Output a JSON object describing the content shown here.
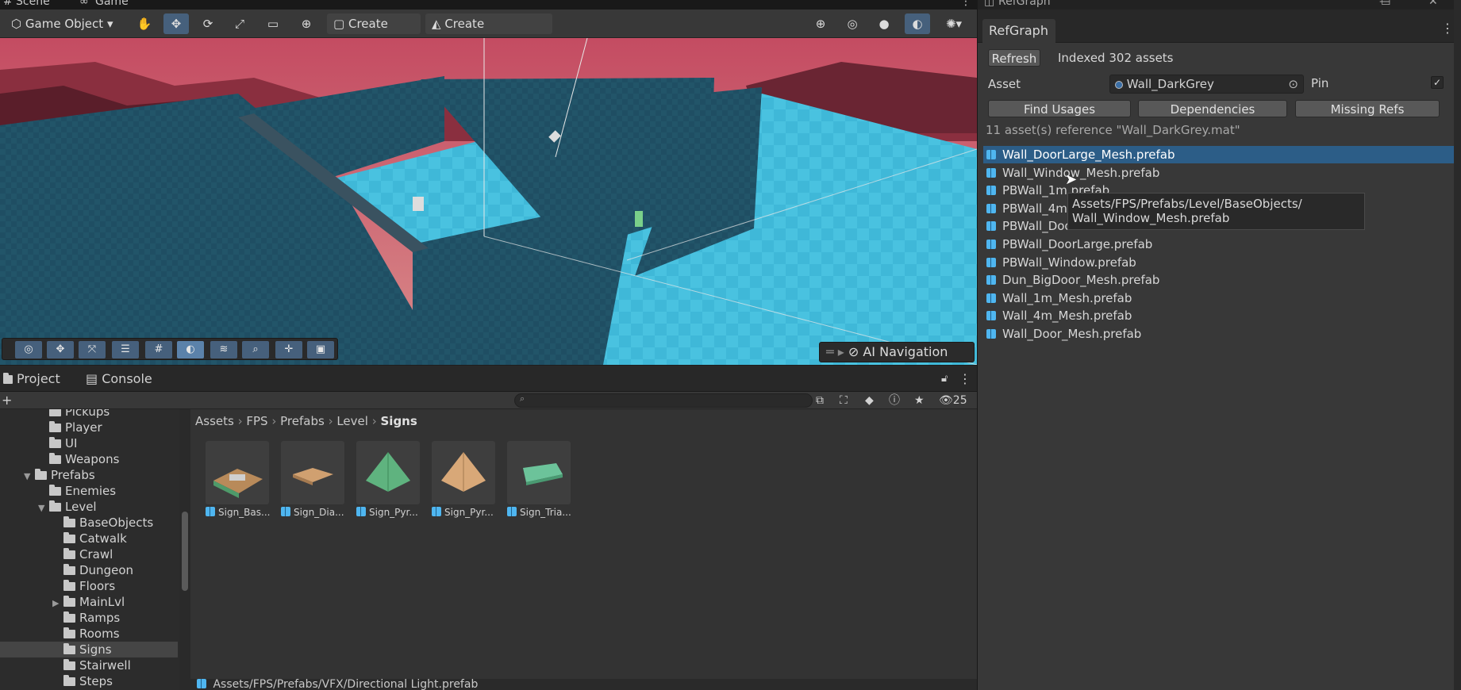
{
  "scene": {
    "tabs": [
      "Scene",
      "Game"
    ],
    "toolbar": {
      "game_object_label": "Game Object",
      "create_cube_label": "Create Cube",
      "create_polyshape_label": "Create PolyShape"
    },
    "ai_navigation_label": "AI Navigation"
  },
  "project": {
    "tabs": [
      "Project",
      "Console"
    ],
    "hidden_count": "25",
    "tree": [
      {
        "label": "Pickups",
        "indent": 2
      },
      {
        "label": "Player",
        "indent": 2
      },
      {
        "label": "UI",
        "indent": 2
      },
      {
        "label": "Weapons",
        "indent": 2
      },
      {
        "label": "Prefabs",
        "indent": 1,
        "expanded": true
      },
      {
        "label": "Enemies",
        "indent": 2
      },
      {
        "label": "Level",
        "indent": 2,
        "expanded": true
      },
      {
        "label": "BaseObjects",
        "indent": 3
      },
      {
        "label": "Catwalk",
        "indent": 3
      },
      {
        "label": "Crawl",
        "indent": 3
      },
      {
        "label": "Dungeon",
        "indent": 3
      },
      {
        "label": "Floors",
        "indent": 3
      },
      {
        "label": "MainLvl",
        "indent": 3,
        "collapsed": true
      },
      {
        "label": "Ramps",
        "indent": 3
      },
      {
        "label": "Rooms",
        "indent": 3
      },
      {
        "label": "Signs",
        "indent": 3,
        "selected": true
      },
      {
        "label": "Stairwell",
        "indent": 3
      },
      {
        "label": "Steps",
        "indent": 3
      }
    ],
    "breadcrumb": [
      "Assets",
      "FPS",
      "Prefabs",
      "Level",
      "Signs"
    ],
    "assets": [
      {
        "label": "Sign_Bas..."
      },
      {
        "label": "Sign_Dia..."
      },
      {
        "label": "Sign_Pyr..."
      },
      {
        "label": "Sign_Pyr..."
      },
      {
        "label": "Sign_Tria..."
      }
    ],
    "footer_path": "Assets/FPS/Prefabs/VFX/Directional Light.prefab"
  },
  "refgraph": {
    "window_title": "RefGraph",
    "tab_label": "RefGraph",
    "refresh_label": "Refresh",
    "indexed_text": "Indexed 302 assets",
    "asset_label": "Asset",
    "asset_value": "Wall_DarkGrey",
    "pin_label": "Pin",
    "find_usages_label": "Find Usages",
    "dependencies_label": "Dependencies",
    "missing_refs_label": "Missing Refs",
    "result_summary": "11 asset(s) reference \"Wall_DarkGrey.mat\"",
    "results": [
      "Wall_DoorLarge_Mesh.prefab",
      "Wall_Window_Mesh.prefab",
      "PBWall_1m.prefab",
      "PBWall_4m",
      "PBWall_Doo",
      "PBWall_DoorLarge.prefab",
      "PBWall_Window.prefab",
      "Dun_BigDoor_Mesh.prefab",
      "Wall_1m_Mesh.prefab",
      "Wall_4m_Mesh.prefab",
      "Wall_Door_Mesh.prefab"
    ],
    "tooltip_line1": "Assets/FPS/Prefabs/Level/BaseObjects/",
    "tooltip_line2": "Wall_Window_Mesh.prefab"
  },
  "colors": {
    "accent": "#46607c",
    "selection": "#2c5d87",
    "sky": "#c0566a",
    "water": "#3fb8d8"
  }
}
